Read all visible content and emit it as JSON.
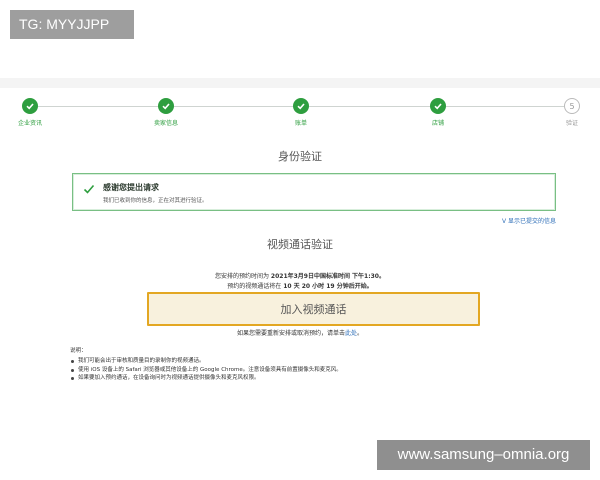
{
  "overlay": {
    "tg_label": "TG: MYYJJPP",
    "watermark": "www.samsung–omnia.org"
  },
  "stepper": {
    "steps": [
      {
        "label": "企业资讯",
        "state": "done"
      },
      {
        "label": "卖家信息",
        "state": "done"
      },
      {
        "label": "账单",
        "state": "done"
      },
      {
        "label": "店铺",
        "state": "done"
      },
      {
        "label": "验证",
        "state": "current",
        "number": "5"
      }
    ]
  },
  "identity": {
    "title": "身份验证",
    "success_heading": "感谢您提出请求",
    "success_sub": "我们已收到你的信息，正在对其进行验证。",
    "show_info_link": "V 显示已提交的信息"
  },
  "video": {
    "title": "视频通话验证",
    "appt_line1_prefix": "您安排的预约时间为 ",
    "appt_line1_value": "2021年3月9日中国标准时间 下午1:30。",
    "appt_line2_prefix": "预约的视频通话将在 ",
    "appt_line2_value": "10 天 20 小时 19 分钟后开始。",
    "join_button": "加入视频通话",
    "reschedule_prefix": "如果您需要重新安排或取消预约，请单击",
    "reschedule_link": "此处",
    "reschedule_suffix": "。"
  },
  "notes": {
    "title": "说明：",
    "items": [
      "我们可能会出于审核和质量目的录制你的视频通话。",
      "使用 iOS 设备上的 Safari 浏览器或其他设备上的 Google Chrome。注意设备须具有前置摄像头和麦克风。",
      "如果要加入预约通话，在设备询问时为视频通话提供摄像头和麦克风权限。"
    ]
  },
  "colors": {
    "success_green": "#2e9e3f",
    "link_blue": "#2f6fb8",
    "button_border": "#e3a722",
    "button_fill": "#f8f1dd"
  }
}
